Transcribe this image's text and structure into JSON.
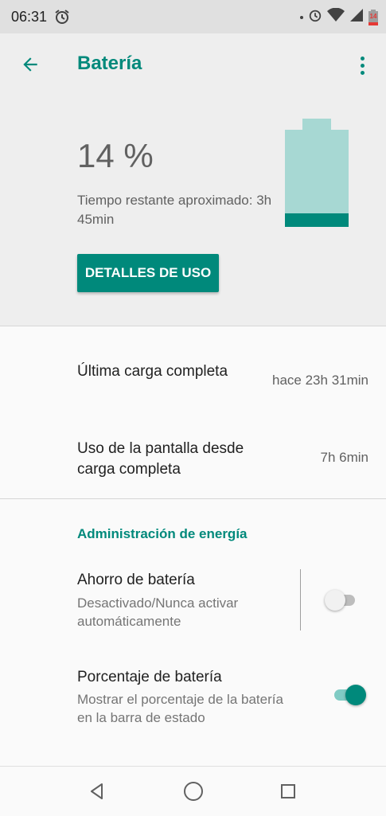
{
  "statusbar": {
    "time": "06:31",
    "battery_level": "14"
  },
  "header": {
    "title": "Batería"
  },
  "battery": {
    "percent": "14 %",
    "remaining": "Tiempo restante aproximado: 3h 45min",
    "level_fraction": 0.14,
    "button_label": "DETALLES DE USO"
  },
  "info": [
    {
      "label": "Última carga completa",
      "value": "hace 23h 31min"
    },
    {
      "label": "Uso de la pantalla desde carga completa",
      "value": "7h 6min"
    }
  ],
  "power": {
    "section_title": "Administración de energía",
    "saver": {
      "title": "Ahorro de batería",
      "subtitle": "Desactivado/Nunca activar automáticamente",
      "enabled": false
    },
    "percentage": {
      "title": "Porcentaje de batería",
      "subtitle": "Mostrar el porcentaje de la batería en la barra de estado",
      "enabled": true
    }
  },
  "colors": {
    "accent": "#00897b",
    "battery_light": "#a7d8d3"
  }
}
